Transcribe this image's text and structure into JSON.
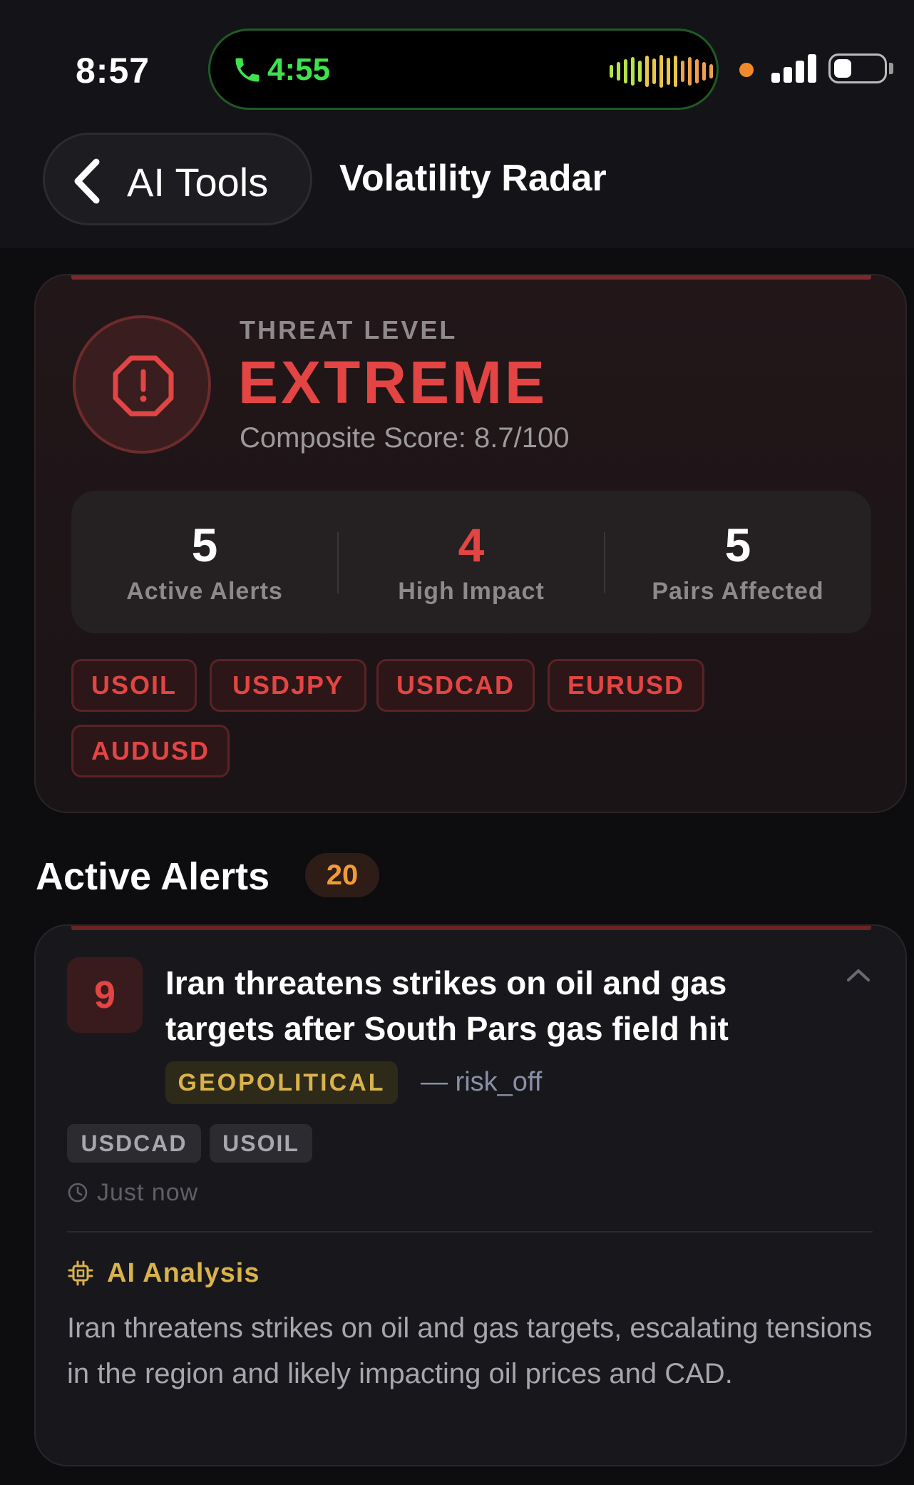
{
  "status_bar": {
    "time": "8:57",
    "call_time": "4:55"
  },
  "nav": {
    "back_label": "AI Tools",
    "title": "Volatility Radar"
  },
  "threat": {
    "label": "THREAT LEVEL",
    "value": "EXTREME",
    "composite_score": "Composite Score: 8.7/100",
    "stats": [
      {
        "value": "5",
        "label": "Active Alerts",
        "color": "#ffffff"
      },
      {
        "value": "4",
        "label": "High Impact",
        "color": "#e24543"
      },
      {
        "value": "5",
        "label": "Pairs Affected",
        "color": "#ffffff"
      }
    ],
    "pairs": [
      "USOIL",
      "USDJPY",
      "USDCAD",
      "EURUSD",
      "AUDUSD"
    ]
  },
  "alerts_section": {
    "heading": "Active Alerts",
    "count": "20"
  },
  "alert": {
    "score": "9",
    "title": "Iran threatens strikes on oil and gas targets after South Pars gas field hit",
    "category": "GEOPOLITICAL",
    "sentiment": "— risk_off",
    "pairs": [
      "USDCAD",
      "USOIL"
    ],
    "time": "Just now",
    "ai_label": "AI Analysis",
    "ai_text": "Iran threatens strikes on oil and gas targets, escalating tensions in the region and likely impacting oil prices and CAD."
  },
  "colors": {
    "danger": "#e24543",
    "accent_orange": "#f29a38",
    "accent_gold": "#d9b24a",
    "call_green": "#3ee24f"
  }
}
